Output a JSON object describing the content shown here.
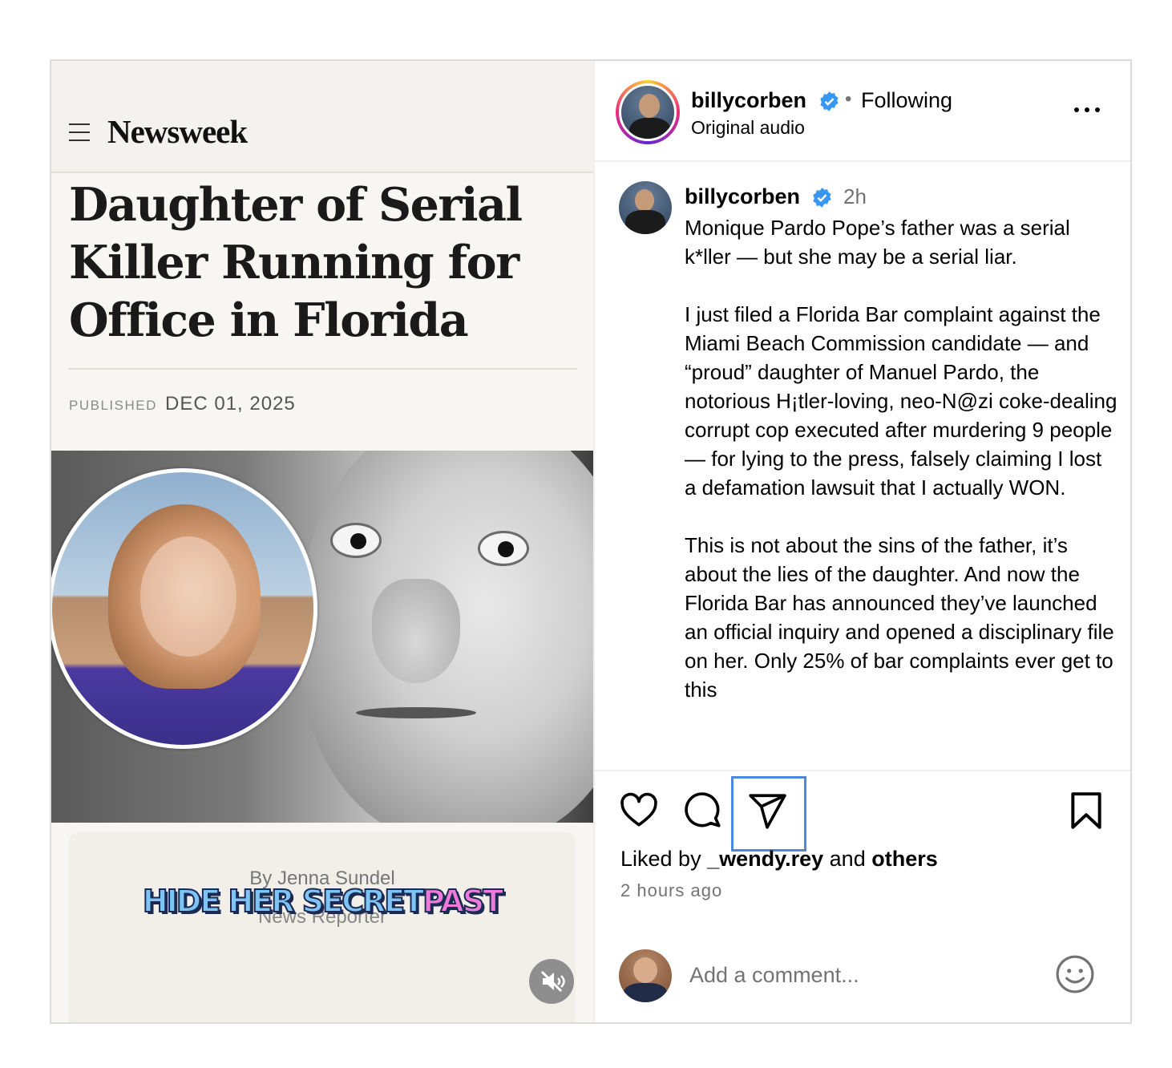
{
  "media": {
    "publication": "Newsweek",
    "headline": "Daughter of Serial Killer Running for Office in Florida",
    "published_label": "PUBLISHED",
    "published_date": "DEC 01, 2025",
    "byline": "By Jenna Sundel",
    "byline_role": "News Reporter",
    "overlay_caption_main": "HIDE HER SECRET",
    "overlay_caption_accent": "PAST",
    "mute_icon": "speaker-muted-icon"
  },
  "header": {
    "username": "billycorben",
    "separator": "•",
    "follow_status": "Following",
    "audio": "Original audio"
  },
  "caption": {
    "username": "billycorben",
    "time": "2h",
    "text": "Monique Pardo Pope’s father was a serial k*ller — but she may be a serial liar.\n\nI just filed a Florida Bar complaint against the Miami Beach Commission candidate — and “proud” daughter of Manuel Pardo, the notorious H¡tler-loving, neo-N@zi coke-dealing corrupt cop executed after murdering 9 people — for lying to the press, falsely claiming I lost a defamation lawsuit that I actually WON.\n\nThis is not about the sins of the father, it’s about the lies of the daughter. And now the Florida Bar has announced they’ve launched an official inquiry and opened a disciplinary file on her. Only 25% of bar complaints ever get to this"
  },
  "actions": {
    "likes_prefix": "Liked by ",
    "liked_by_user": "_wendy.rey",
    "likes_middle": " and ",
    "likes_others": "others",
    "timestamp": "2 hours ago"
  },
  "comment": {
    "placeholder": "Add a comment..."
  },
  "colors": {
    "verified_badge": "#3897f0",
    "focus_ring": "#4a8ad8",
    "secondary_text": "#737373"
  }
}
